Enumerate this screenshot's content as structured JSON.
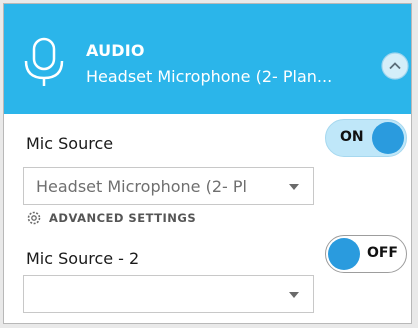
{
  "header": {
    "icon": "microphone-icon",
    "title": "AUDIO",
    "device": "Headset Microphone (2- Plan...",
    "collapse_icon": "chevron-up-icon",
    "background_color": "#2bb5ea"
  },
  "mic_source": {
    "label": "Mic Source",
    "toggle_state": "ON",
    "dropdown_value": "Headset Microphone (2- Pl",
    "dropdown_icon": "chevron-down-icon"
  },
  "advanced_settings": {
    "icon": "gear-icon",
    "label": "ADVANCED SETTINGS"
  },
  "mic_source_2": {
    "label": "Mic Source - 2",
    "toggle_state": "OFF",
    "dropdown_value": "",
    "dropdown_icon": "chevron-down-icon"
  },
  "colors": {
    "accent": "#2a9bde",
    "toggle_on_track": "#bfe7f9"
  }
}
